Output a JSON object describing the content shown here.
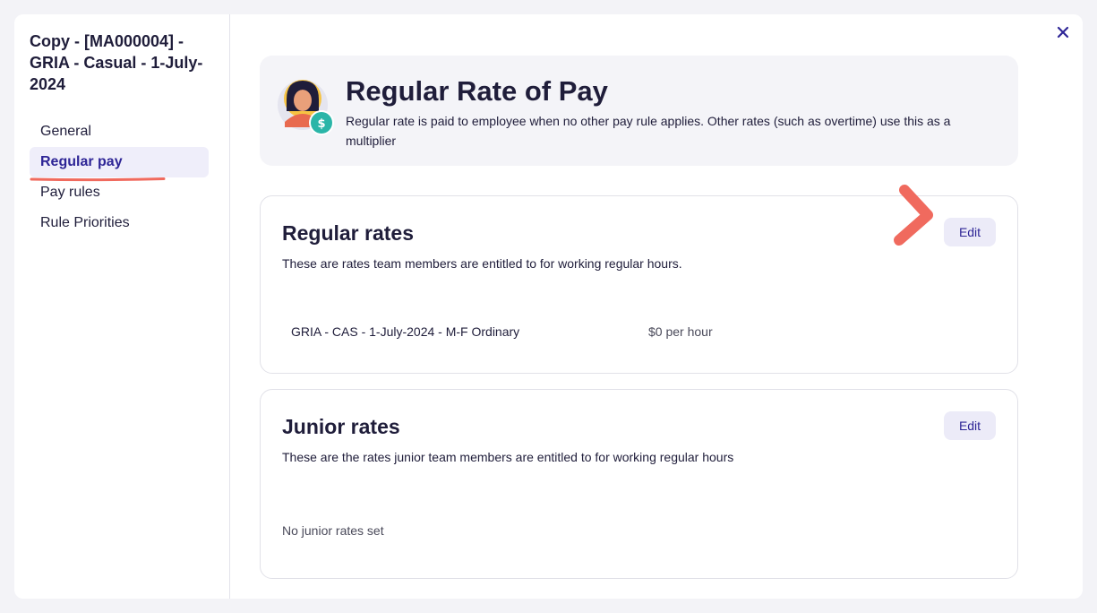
{
  "sidebar": {
    "title": "Copy - [MA000004] - GRIA - Casual - 1-July-2024",
    "items": [
      {
        "label": "General",
        "active": false
      },
      {
        "label": "Regular pay",
        "active": true
      },
      {
        "label": "Pay rules",
        "active": false
      },
      {
        "label": "Rule Priorities",
        "active": false
      }
    ]
  },
  "header": {
    "close_icon": "close-icon"
  },
  "banner": {
    "title": "Regular Rate of Pay",
    "description": "Regular rate is paid to employee when no other pay rule applies. Other rates (such as overtime) use this as a multiplier",
    "avatar_icon": "avatar-with-dollar-coin"
  },
  "regular_rates": {
    "title": "Regular rates",
    "description": "These are rates team members are entitled to for working regular hours.",
    "edit_label": "Edit",
    "rows": [
      {
        "name": "GRIA - CAS - 1-July-2024 - M-F Ordinary",
        "value": "$0 per hour"
      }
    ]
  },
  "junior_rates": {
    "title": "Junior rates",
    "description": "These are the rates junior team members are entitled to for working regular hours",
    "edit_label": "Edit",
    "empty_text": "No junior rates set"
  },
  "colors": {
    "accent": "#2e2596",
    "annotation": "#f06a5e",
    "active_bg": "#efeefa"
  }
}
